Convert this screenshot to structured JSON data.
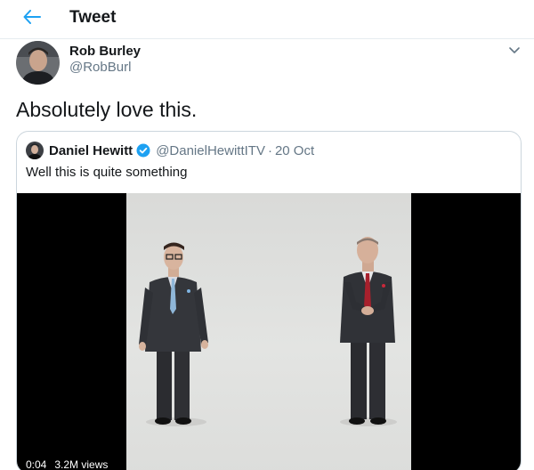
{
  "header": {
    "title": "Tweet",
    "back_icon": "arrow-left-icon",
    "accent_color": "#1da1f2"
  },
  "tweet": {
    "author": {
      "name": "Rob Burley",
      "handle": "@RobBurl",
      "avatar_icon": "user-avatar"
    },
    "menu_icon": "chevron-down-icon",
    "text": "Absolutely love this."
  },
  "quoted_tweet": {
    "author": {
      "name": "Daniel Hewitt",
      "handle": "@DanielHewittITV",
      "verified": true,
      "verified_icon": "verified-badge-icon",
      "avatar_icon": "user-avatar"
    },
    "separator": "·",
    "date": "20 Oct",
    "text": "Well this is quite something",
    "video": {
      "elapsed": "0:04",
      "views": "3.2M views"
    }
  }
}
